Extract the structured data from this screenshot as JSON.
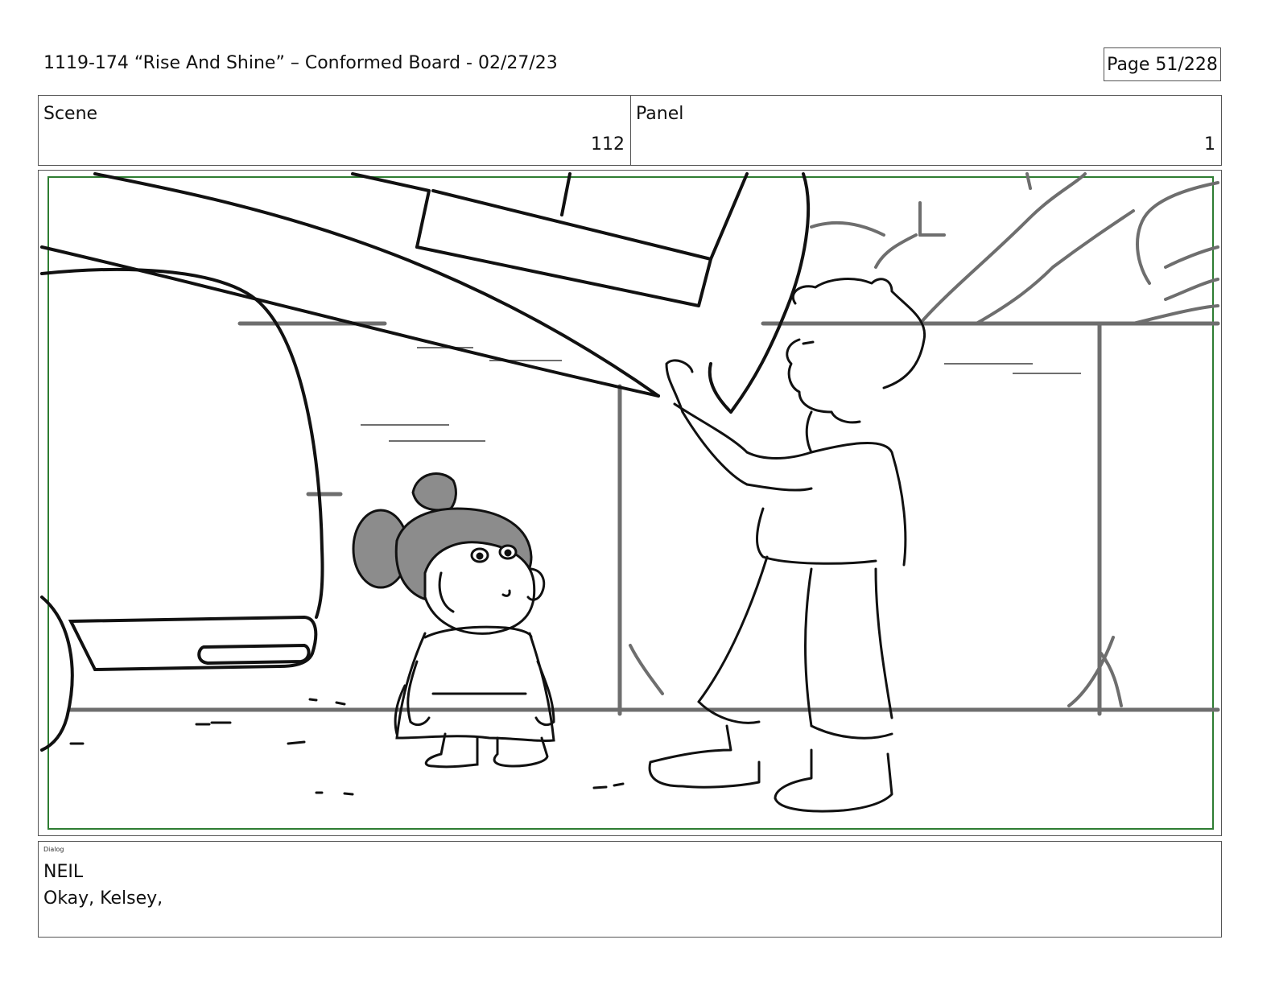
{
  "header": {
    "title": "1119-174 “Rise And Shine” – Conformed Board - 02/27/23",
    "page": "Page  51/228"
  },
  "info": {
    "scene_label": "Scene",
    "scene_value": "112",
    "panel_label": "Panel",
    "panel_value": "1"
  },
  "dialog": {
    "label": "Dialog",
    "speaker": "NEIL",
    "line": "Okay, Kelsey,"
  },
  "colors": {
    "safe_frame": "#2e7d32",
    "sketch_line": "#111111",
    "background_line": "#6e6e6e",
    "hair_fill": "#8c8c8c"
  }
}
